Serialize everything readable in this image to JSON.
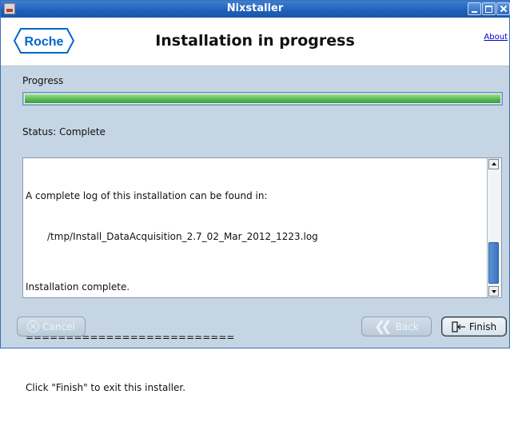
{
  "window": {
    "title": "Nixstaller"
  },
  "header": {
    "logo_text": "Roche",
    "title": "Installation in progress",
    "about_label": "About"
  },
  "progress": {
    "label": "Progress",
    "fraction": 1.0
  },
  "status": {
    "text": "Status: Complete"
  },
  "log": {
    "lines": [
      "A complete log of this installation can be found in:",
      "/tmp/Install_DataAcquisition_2.7_02_Mar_2012_1223.log",
      "Installation complete.",
      "==========================",
      "Click \"Finish\" to exit this installer."
    ]
  },
  "buttons": {
    "cancel_label": "Cancel",
    "back_label": "Back",
    "finish_label": "Finish"
  },
  "colors": {
    "titlebar": "#1e5fb8",
    "window_bg": "#c5d5e3",
    "progress_fill": "#5fbd56",
    "brand": "#0066cc"
  },
  "icons": {
    "app": "app-icon",
    "minimize": "minimize-icon",
    "maximize": "maximize-icon",
    "close": "close-icon",
    "cancel": "cancel-circle-icon",
    "back": "double-chevron-left-icon",
    "finish": "exit-door-icon"
  }
}
